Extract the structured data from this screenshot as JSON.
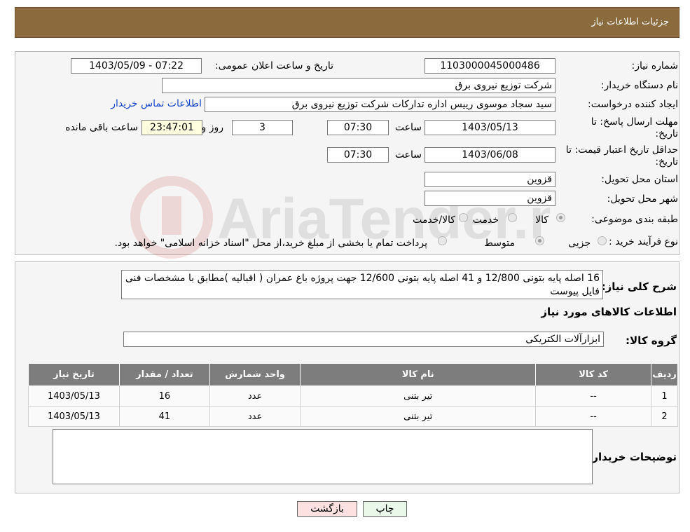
{
  "header": {
    "title": "جزئیات اطلاعات نیاز"
  },
  "form": {
    "need_number_label": "شماره نیاز:",
    "need_number": "1103000045000486",
    "announce_label": "تاریخ و ساعت اعلان عمومی:",
    "announce_value": "1403/05/09 - 07:22",
    "buyer_org_label": "نام دستگاه خریدار:",
    "buyer_org": "شرکت توزیع نیروی برق",
    "creator_label": "ایجاد کننده درخواست:",
    "creator": "سید سجاد موسوی رییس اداره تدارکات شرکت توزیع نیروی برق",
    "contact_link": "اطلاعات تماس خریدار",
    "deadline_label_line1": "مهلت ارسال پاسخ: تا",
    "deadline_label_line2": "تاریخ:",
    "deadline_date": "1403/05/13",
    "time_label": "ساعت",
    "deadline_time": "07:30",
    "days_value": "3",
    "days_label": "روز و",
    "remaining_value": "23:47:01",
    "remaining_label": "ساعت باقی مانده",
    "validity_label_line1": "حداقل تاریخ اعتبار قیمت: تا",
    "validity_label_line2": "تاریخ:",
    "validity_date": "1403/06/08",
    "validity_time": "07:30",
    "province_label": "استان محل تحویل:",
    "province": "قزوین",
    "city_label": "شهر محل تحویل:",
    "city": "قزوین",
    "category_label": "طبقه بندی موضوعی:",
    "category_options": [
      "کالا",
      "خدمت",
      "کالا/خدمت"
    ],
    "purchase_type_label": "نوع فرآیند خرید :",
    "purchase_options": [
      "جزیی",
      "متوسط"
    ],
    "purchase_note": "پرداخت تمام یا بخشی از مبلغ خرید،از محل \"اسناد خزانه اسلامی\" خواهد بود."
  },
  "details": {
    "description_label": "شرح کلی نیاز:",
    "description": "16 اصله پایه بتونی 12/800 و 41 اصله پایه بتونی 12/600  جهت پروژه باغ عمران ( اقبالیه )مطابق با مشخصات فنی فایل پیوست",
    "goods_info_title": "اطلاعات کالاهای مورد نیاز",
    "goods_group_label": "گروه کالا:",
    "goods_group": "ابزارآلات الکتریکی",
    "table": {
      "headers": [
        "ردیف",
        "کد کالا",
        "نام کالا",
        "واحد شمارش",
        "تعداد / مقدار",
        "تاریخ نیاز"
      ],
      "rows": [
        [
          "1",
          "--",
          "تیر بتنی",
          "عدد",
          "16",
          "1403/05/13"
        ],
        [
          "2",
          "--",
          "تیر بتنی",
          "عدد",
          "41",
          "1403/05/13"
        ]
      ]
    },
    "buyer_notes_label": "توضیحات خریدار:"
  },
  "buttons": {
    "print": "چاپ",
    "back": "بازگشت"
  },
  "watermark_text": "AriaTender.neT"
}
